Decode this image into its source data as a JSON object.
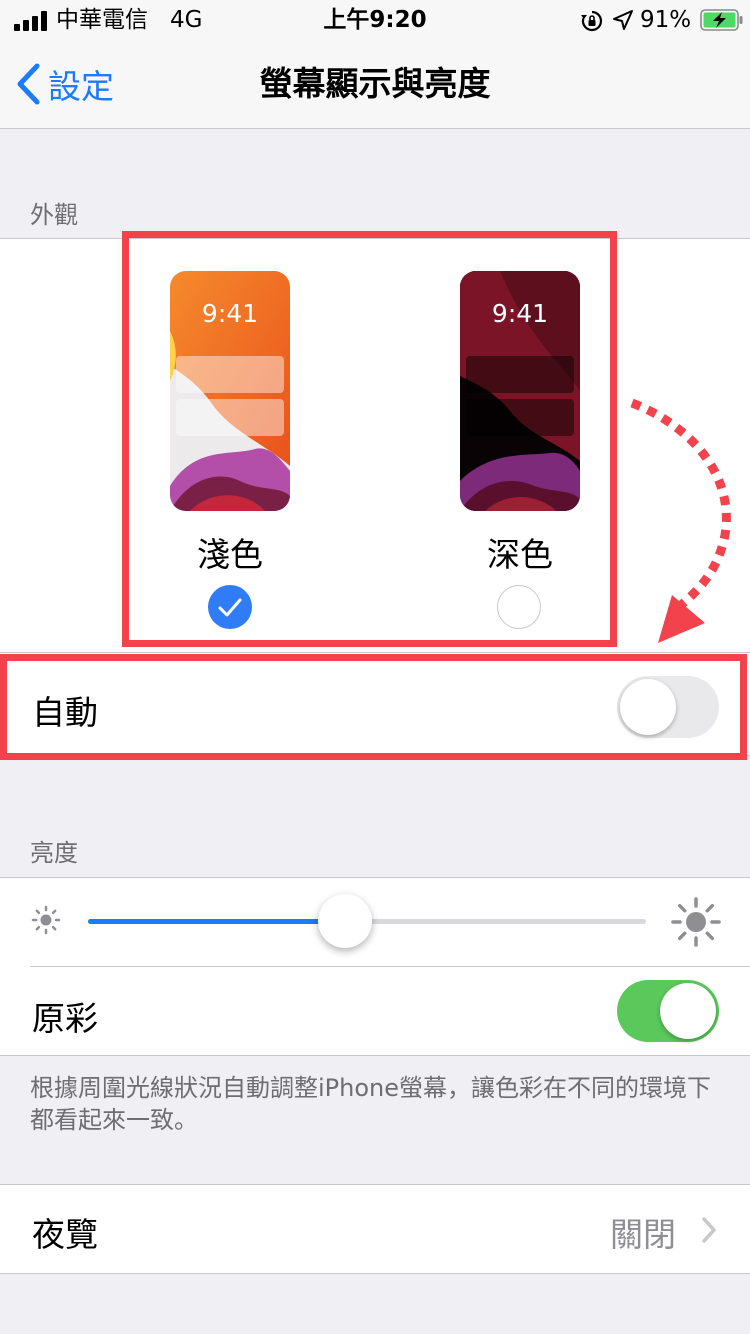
{
  "status_bar": {
    "carrier": "中華電信",
    "network": "4G",
    "time": "上午9:20",
    "battery_percent": "91%"
  },
  "nav": {
    "back_label": "設定",
    "title": "螢幕顯示與亮度"
  },
  "appearance": {
    "header": "外觀",
    "light": {
      "preview_time": "9:41",
      "label": "淺色",
      "selected": true
    },
    "dark": {
      "preview_time": "9:41",
      "label": "深色",
      "selected": false
    },
    "auto": {
      "label": "自動",
      "on": false
    }
  },
  "brightness": {
    "header": "亮度",
    "level": 0.46,
    "true_tone": {
      "label": "原彩",
      "on": true
    },
    "footer": "根據周圍光線狀況自動調整iPhone螢幕，讓色彩在不同的環境下都看起來一致。"
  },
  "night_shift": {
    "label": "夜覽",
    "value": "關閉"
  },
  "colors": {
    "accent": "#1a7cf6",
    "toggle_on": "#5ac85a",
    "annotation_red": "#f2434d"
  }
}
